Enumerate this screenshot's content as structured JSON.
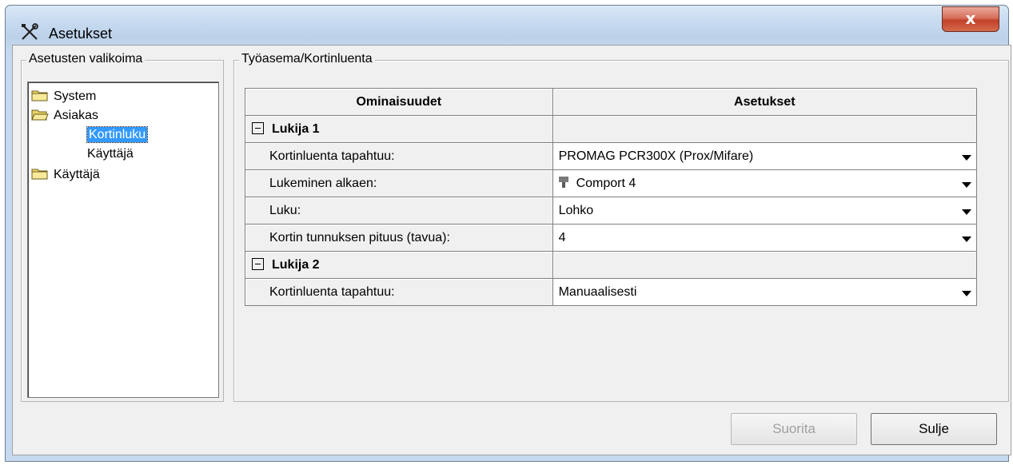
{
  "window": {
    "title": "Asetukset",
    "title_icon": "tools-icon",
    "close_label": "x"
  },
  "left_panel": {
    "legend": "Asetusten valikoima",
    "tree": [
      {
        "label": "System",
        "icon": "folder-closed-icon",
        "level": 0,
        "selected": false
      },
      {
        "label": "Asiakas",
        "icon": "folder-open-icon",
        "level": 0,
        "selected": false
      },
      {
        "label": "Kortinluku",
        "icon": "",
        "level": 1,
        "selected": true
      },
      {
        "label": "Käyttäjä",
        "icon": "",
        "level": 1,
        "selected": false
      },
      {
        "label": "Käyttäjä",
        "icon": "folder-closed-icon",
        "level": 0,
        "selected": false
      }
    ]
  },
  "right_panel": {
    "legend": "Työasema/Kortinluenta",
    "grid": {
      "headers": [
        "Ominaisuudet",
        "Asetukset"
      ],
      "rows": [
        {
          "type": "category",
          "name": "Lukija 1",
          "value": ""
        },
        {
          "type": "property",
          "name": "Kortinluenta tapahtuu:",
          "value": "PROMAG PCR300X (Prox/Mifare)",
          "icon": ""
        },
        {
          "type": "property",
          "name": "Lukeminen alkaen:",
          "value": "Comport 4",
          "icon": "serial-port-icon"
        },
        {
          "type": "property",
          "name": "Luku:",
          "value": "Lohko",
          "icon": ""
        },
        {
          "type": "property",
          "name": "Kortin tunnuksen pituus (tavua):",
          "value": "4",
          "icon": ""
        },
        {
          "type": "category",
          "name": "Lukija 2",
          "value": ""
        },
        {
          "type": "property",
          "name": "Kortinluenta tapahtuu:",
          "value": "Manuaalisesti",
          "icon": ""
        }
      ]
    }
  },
  "buttons": {
    "apply_label": "Suorita",
    "apply_enabled": false,
    "close_label": "Sulje"
  },
  "colors": {
    "selection": "#3399ff",
    "close_button": "#c7503a",
    "dialog_background": "#f0f0f0"
  }
}
